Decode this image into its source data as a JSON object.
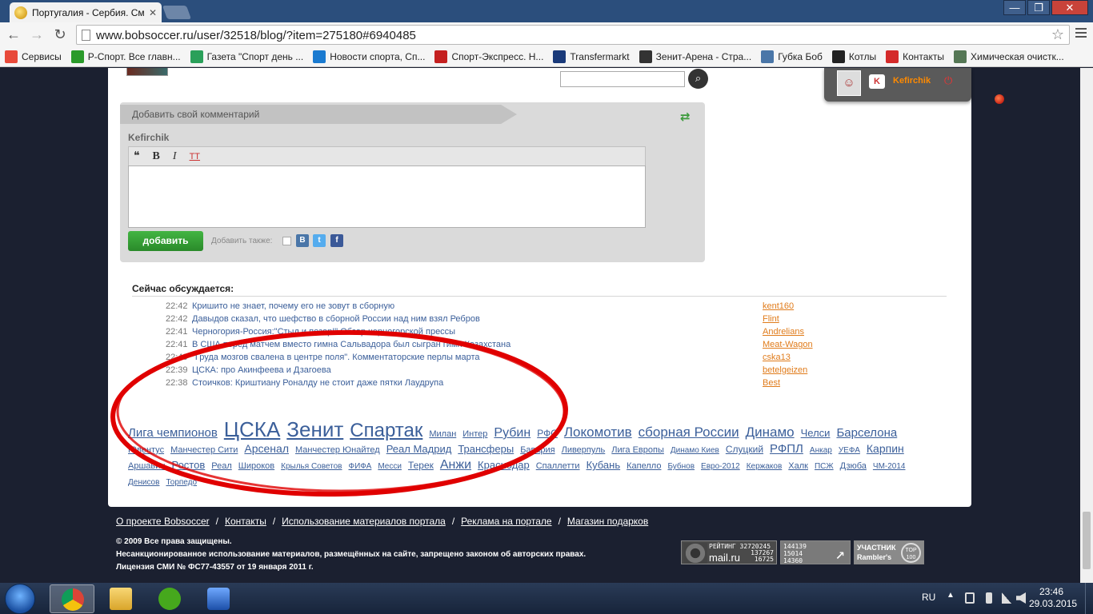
{
  "browser": {
    "tab_title": "Португалия - Сербия. См",
    "url": "www.bobsoccer.ru/user/32518/blog/?item=275180#6940485",
    "bookmarks": [
      {
        "label": "Сервисы",
        "icon": "apps-grid-icon",
        "color": "#e84a3a"
      },
      {
        "label": "Р-Спорт. Все главн...",
        "icon": "leaf-icon",
        "color": "#2a9a2a"
      },
      {
        "label": "Газета \"Спорт день ...",
        "icon": "c-logo-icon",
        "color": "#2aa05a"
      },
      {
        "label": "Новости спорта, Сп...",
        "icon": "sb-logo-icon",
        "color": "#1a7ad0"
      },
      {
        "label": "Спорт-Экспресс. Н...",
        "icon": "dragon-icon",
        "color": "#c42020"
      },
      {
        "label": "Transfermarkt",
        "icon": "tm-logo-icon",
        "color": "#1a3a7a"
      },
      {
        "label": "Зенит-Арена - Стра...",
        "icon": "ball-icon",
        "color": "#333333"
      },
      {
        "label": "Губка Боб",
        "icon": "vk-icon",
        "color": "#4a76a8"
      },
      {
        "label": "Котлы",
        "icon": "q-logo-icon",
        "color": "#222222"
      },
      {
        "label": "Контакты",
        "icon": "k-logo-icon",
        "color": "#d42a2a"
      },
      {
        "label": "Химическая очистк...",
        "icon": "tree-icon",
        "color": "#557755"
      }
    ]
  },
  "header": {
    "username": "Kefirchik"
  },
  "comment_form": {
    "title": "Добавить свой комментарий",
    "author": "Kefirchik",
    "tools": [
      "❝",
      "B",
      "I",
      "TT"
    ],
    "submit_label": "добавить",
    "also_label": "Добавить также:",
    "share": [
      {
        "icon": "vk-icon",
        "glyph": "B",
        "color": "#4a76a8"
      },
      {
        "icon": "twitter-icon",
        "glyph": "t",
        "color": "#55acee"
      },
      {
        "icon": "facebook-icon",
        "glyph": "f",
        "color": "#3b5998"
      }
    ]
  },
  "discussion": {
    "title": "Сейчас обсуждается:",
    "items": [
      {
        "time": "22:42",
        "topic": "Кришито не знает, почему его не зовут в сборную",
        "user": "kent160"
      },
      {
        "time": "22:42",
        "topic": "Давыдов сказал, что шефство в сборной России над ним взял Ребров",
        "user": "Flint"
      },
      {
        "time": "22:41",
        "topic": "Черногория-Россия:\"Стыд и позор!\".Обзор черногорской прессы",
        "user": "Andrelians"
      },
      {
        "time": "22:41",
        "topic": "В США перед матчем вместо гимна Сальвадора был сыгран гимн Казахстана",
        "user": "Meat-Wagon"
      },
      {
        "time": "22:40",
        "topic": "\"Груда мозгов свалена в центре поля\". Комментаторские перлы марта",
        "user": "cska13"
      },
      {
        "time": "22:39",
        "topic": "ЦСКА: про Акинфеева и Дзагоева",
        "user": "betelgeizen"
      },
      {
        "time": "22:38",
        "topic": "Стоичков: Криштиану Роналду не стоит даже пятки Лаудрупа",
        "user": "Best"
      }
    ]
  },
  "tag_cloud": [
    {
      "label": "Лига чемпионов",
      "size": 15
    },
    {
      "label": "ЦСКА",
      "size": 26
    },
    {
      "label": "Зенит",
      "size": 26
    },
    {
      "label": "Спартак",
      "size": 24
    },
    {
      "label": "Милан",
      "size": 11
    },
    {
      "label": "Интер",
      "size": 11
    },
    {
      "label": "Рубин",
      "size": 16
    },
    {
      "label": "РФС",
      "size": 12
    },
    {
      "label": "Локомотив",
      "size": 17
    },
    {
      "label": "сборная России",
      "size": 17
    },
    {
      "label": "Динамо",
      "size": 17
    },
    {
      "label": "Челси",
      "size": 13
    },
    {
      "label": "Барселона",
      "size": 15
    },
    {
      "label": "Ювентус",
      "size": 11
    },
    {
      "label": "Манчестер Сити",
      "size": 11
    },
    {
      "label": "Арсенал",
      "size": 14
    },
    {
      "label": "Манчестер Юнайтед",
      "size": 11
    },
    {
      "label": "Реал Мадрид",
      "size": 13
    },
    {
      "label": "Трансферы",
      "size": 13
    },
    {
      "label": "Бавария",
      "size": 11
    },
    {
      "label": "Ливерпуль",
      "size": 11
    },
    {
      "label": "Лига Европы",
      "size": 11
    },
    {
      "label": "Динамо Киев",
      "size": 10
    },
    {
      "label": "Слуцкий",
      "size": 12
    },
    {
      "label": "РФПЛ",
      "size": 15
    },
    {
      "label": "Анкар",
      "size": 10
    },
    {
      "label": "УЕФА",
      "size": 10
    },
    {
      "label": "Карпин",
      "size": 14
    },
    {
      "label": "Аршавин",
      "size": 11
    },
    {
      "label": "Ростов",
      "size": 13
    },
    {
      "label": "Реал",
      "size": 11
    },
    {
      "label": "Широков",
      "size": 11
    },
    {
      "label": "Крылья Советов",
      "size": 10
    },
    {
      "label": "ФИФА",
      "size": 10
    },
    {
      "label": "Месси",
      "size": 10
    },
    {
      "label": "Терек",
      "size": 12
    },
    {
      "label": "Анжи",
      "size": 16
    },
    {
      "label": "Краснодар",
      "size": 13
    },
    {
      "label": "Спаллетти",
      "size": 11
    },
    {
      "label": "Кубань",
      "size": 13
    },
    {
      "label": "Капелло",
      "size": 11
    },
    {
      "label": "Бубнов",
      "size": 10
    },
    {
      "label": "Евро-2012",
      "size": 10
    },
    {
      "label": "Кержаков",
      "size": 10
    },
    {
      "label": "Халк",
      "size": 11
    },
    {
      "label": "ПСЖ",
      "size": 10
    },
    {
      "label": "Дзюба",
      "size": 11
    },
    {
      "label": "ЧМ-2014",
      "size": 10
    },
    {
      "label": "Денисов",
      "size": 10
    },
    {
      "label": "Торпедо",
      "size": 10
    }
  ],
  "footer": {
    "links": [
      "О проекте Bobsoccer",
      "Контакты",
      "Использование материалов портала",
      "Реклама на портале",
      "Магазин подарков"
    ],
    "legal": [
      "© 2009 Все права защищены.",
      "Несанкционированное использование материалов, размещённых на сайте, запрещено законом об авторских правах.",
      "Лицензия СМИ № ФС77-43557 от 19 января 2011 г."
    ],
    "counters": {
      "mailru_label": "РЕЙТИНГ 32720245",
      "mailru_brand": "mail.ru",
      "mailru_nums": [
        "137267",
        "16725"
      ],
      "li_nums": [
        "144139",
        "15014",
        "14360"
      ],
      "rambler_l1": "УЧАСТНИК",
      "rambler_l2": "Rambler's",
      "rambler_badge": "TOP 100"
    }
  },
  "taskbar": {
    "lang": "RU",
    "time": "23:46",
    "date": "29.03.2015"
  },
  "annotation_color": "#e00000"
}
